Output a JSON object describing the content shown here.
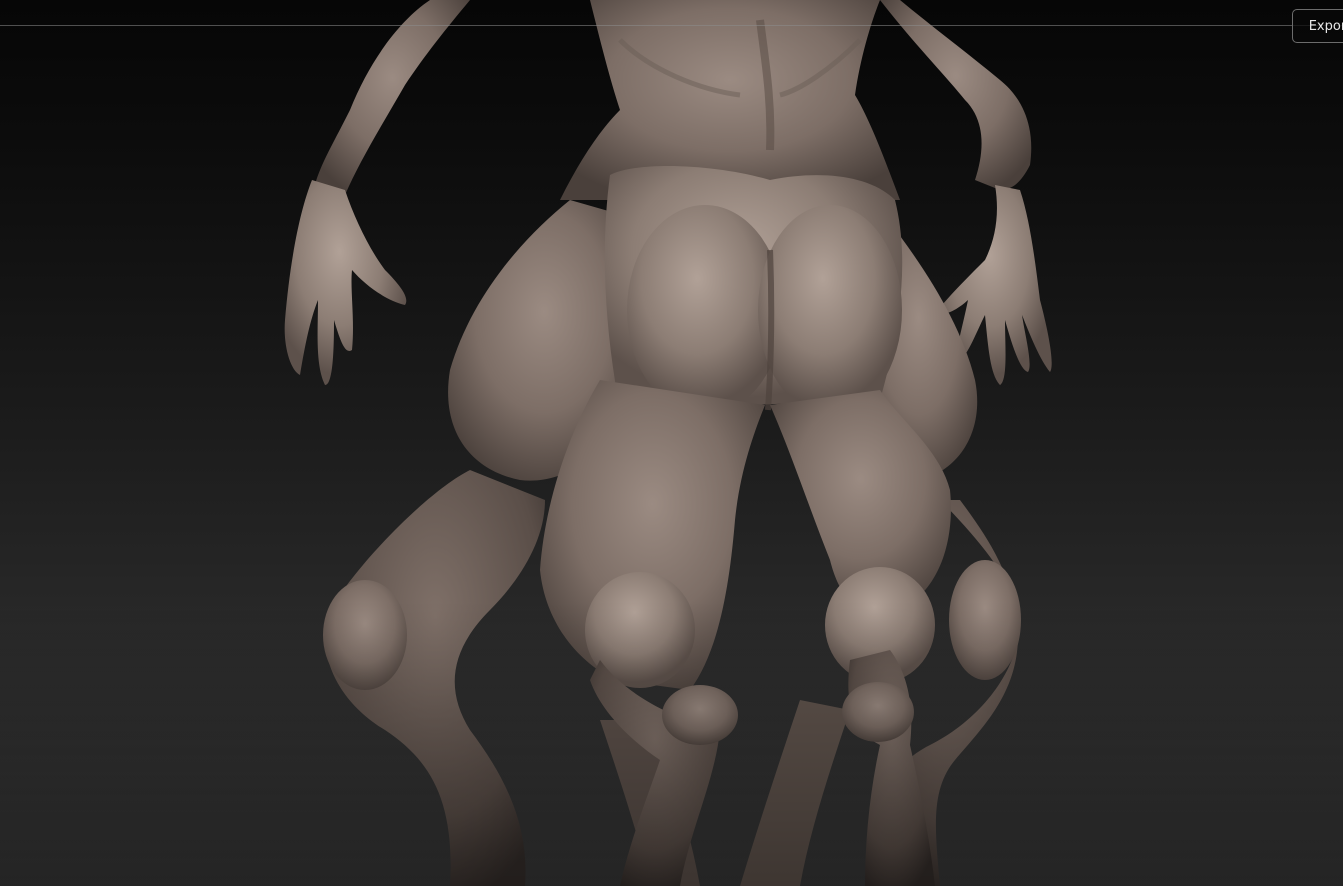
{
  "toolbar": {
    "export_label": "Export"
  },
  "scene": {
    "subject": "creature-sculpt-back-view",
    "background_top": "#060606",
    "background_bottom": "#383838",
    "material_color": "#8a7b72"
  }
}
